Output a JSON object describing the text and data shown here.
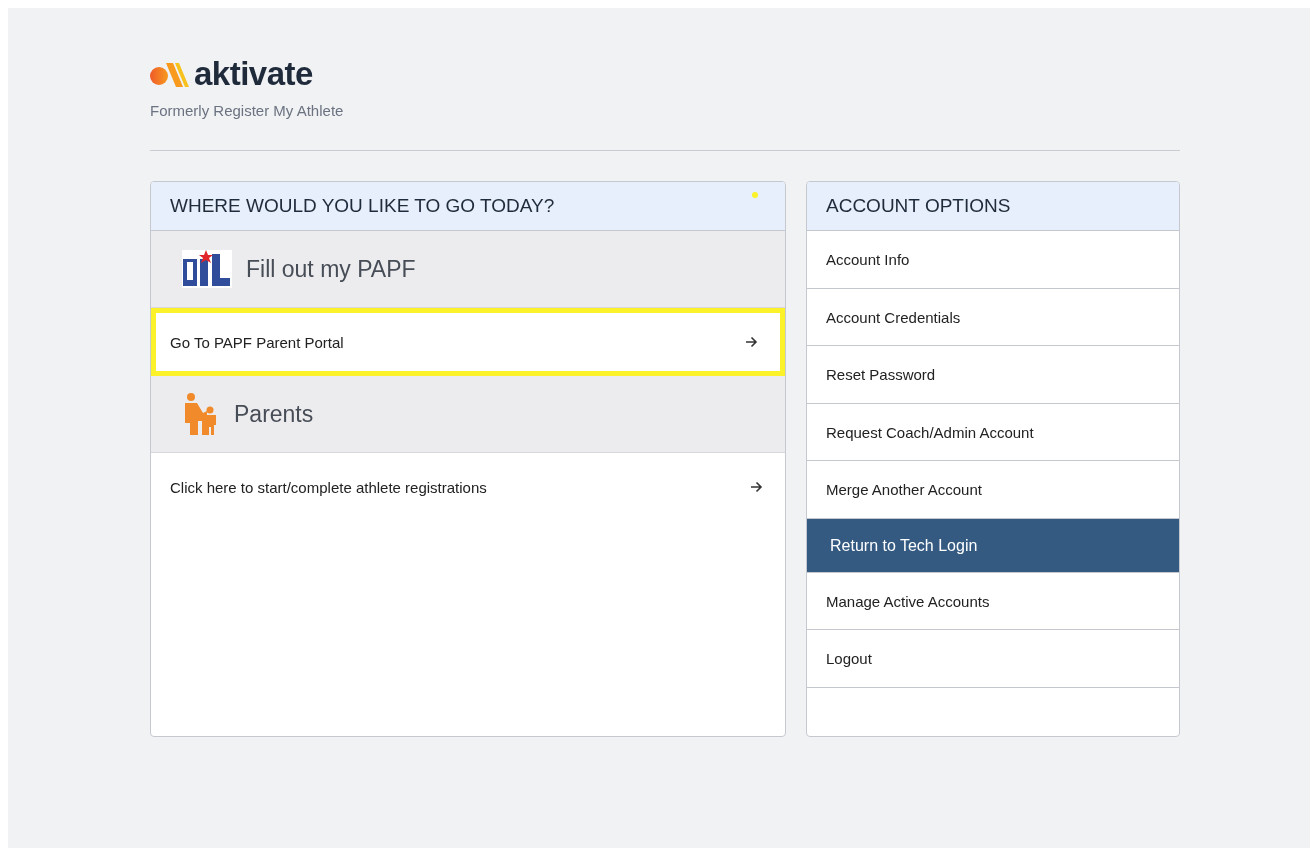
{
  "brand": {
    "name": "aktivate",
    "tagline": "Formerly Register My Athlete"
  },
  "destinations": {
    "title": "WHERE WOULD YOU LIKE TO GO TODAY?",
    "sections": [
      {
        "kind": "papf",
        "heading": "Fill out my PAPF",
        "link": {
          "label": "Go To PAPF Parent Portal",
          "highlighted": true
        }
      },
      {
        "kind": "parents",
        "heading": "Parents",
        "link": {
          "label": "Click here to start/complete athlete registrations",
          "highlighted": false
        }
      }
    ]
  },
  "account_options": {
    "title": "ACCOUNT OPTIONS",
    "items": [
      {
        "label": "Account Info",
        "selected": false
      },
      {
        "label": "Account Credentials",
        "selected": false
      },
      {
        "label": "Reset Password",
        "selected": false
      },
      {
        "label": "Request Coach/Admin Account",
        "selected": false
      },
      {
        "label": "Merge Another Account",
        "selected": false
      },
      {
        "label": "Return to Tech Login",
        "selected": true
      },
      {
        "label": "Manage Active Accounts",
        "selected": false
      },
      {
        "label": "Logout",
        "selected": false
      }
    ]
  }
}
